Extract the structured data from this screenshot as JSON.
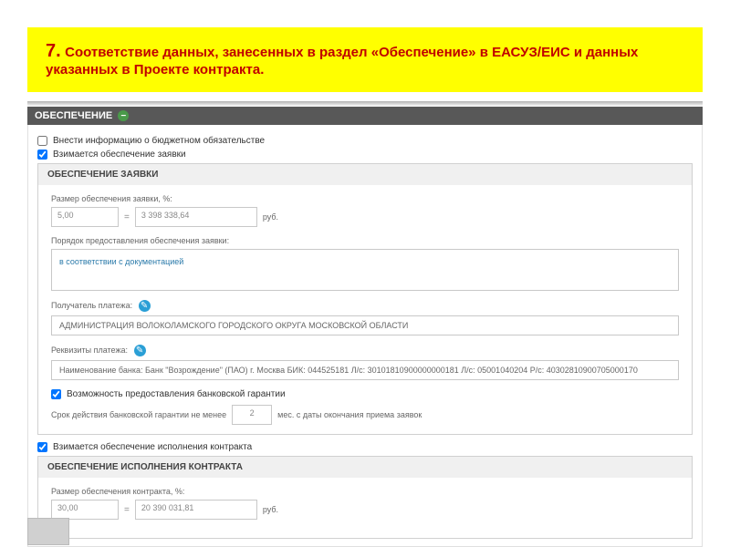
{
  "header": {
    "number": "7.",
    "text": "Соответствие  данных, занесенных в раздел «Обеспечение» в ЕАСУЗ/ЕИС и данных указанных в  Проекте контракта."
  },
  "section": {
    "title": "ОБЕСПЕЧЕНИЕ",
    "collapse_symbol": "−"
  },
  "checkboxes": {
    "budget": {
      "checked": false,
      "label": "Внести информацию о бюджетном обязательстве"
    },
    "zayavka": {
      "checked": true,
      "label": "Взимается обеспечение заявки"
    }
  },
  "zayavka_panel": {
    "title": "ОБЕСПЕЧЕНИЕ ЗАЯВКИ",
    "size_label": "Размер обеспечения заявки, %:",
    "percent": "5,00",
    "amount": "3 398 338,64",
    "unit": "руб.",
    "order_label": "Порядок предоставления обеспечения заявки:",
    "order_value": "в соответствии с документацией",
    "payee_label": "Получатель платежа:",
    "payee_icon": "✎",
    "payee_value": "АДМИНИСТРАЦИЯ ВОЛОКОЛАМСКОГО ГОРОДСКОГО ОКРУГА МОСКОВСКОЙ ОБЛАСТИ",
    "requisites_label": "Реквизиты платежа:",
    "requisites_icon": "✎",
    "requisites_value": "Наименование банка: Банк \"Возрождение\" (ПАО) г. Москва БИК: 044525181 Л/с: 30101810900000000181 Л/с: 05001040204 Р/с: 40302810900705000170",
    "guarantee_cb": {
      "checked": true,
      "label": "Возможность предоставления банковской гарантии"
    },
    "term_prefix": "Срок действия банковской гарантии не менее",
    "term_value": "2",
    "term_suffix": "мес. с даты окончания приема заявок"
  },
  "ispolnenie_cb": {
    "checked": true,
    "label": "Взимается обеспечение исполнения контракта"
  },
  "ispolnenie_panel": {
    "title": "ОБЕСПЕЧЕНИЕ ИСПОЛНЕНИЯ КОНТРАКТА",
    "size_label": "Размер обеспечения контракта, %:",
    "percent": "30,00",
    "amount": "20 390 031,81",
    "unit": "руб."
  }
}
